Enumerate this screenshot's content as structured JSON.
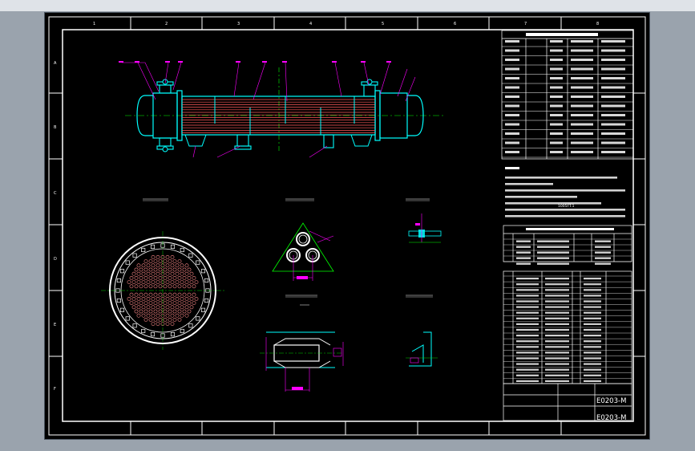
{
  "drawing": {
    "zone_numbers_top": [
      "1",
      "2",
      "3",
      "4",
      "5",
      "6",
      "7",
      "8"
    ],
    "zone_letters_side": [
      "A",
      "B",
      "C",
      "D",
      "E",
      "F"
    ],
    "title_block": {
      "drawing_number": "E0203-M",
      "drawing_number_2": "E0203-M"
    },
    "notes": {
      "test_pressure_value": "1005FT.1"
    },
    "colors": {
      "background": "#000000",
      "frame": "#ffffff",
      "vessel": "#00ffff",
      "tubes": "#ff5a5a",
      "leaders": "#ff00ff",
      "centerline": "#00ff00",
      "dimension": "#ffff00"
    }
  }
}
